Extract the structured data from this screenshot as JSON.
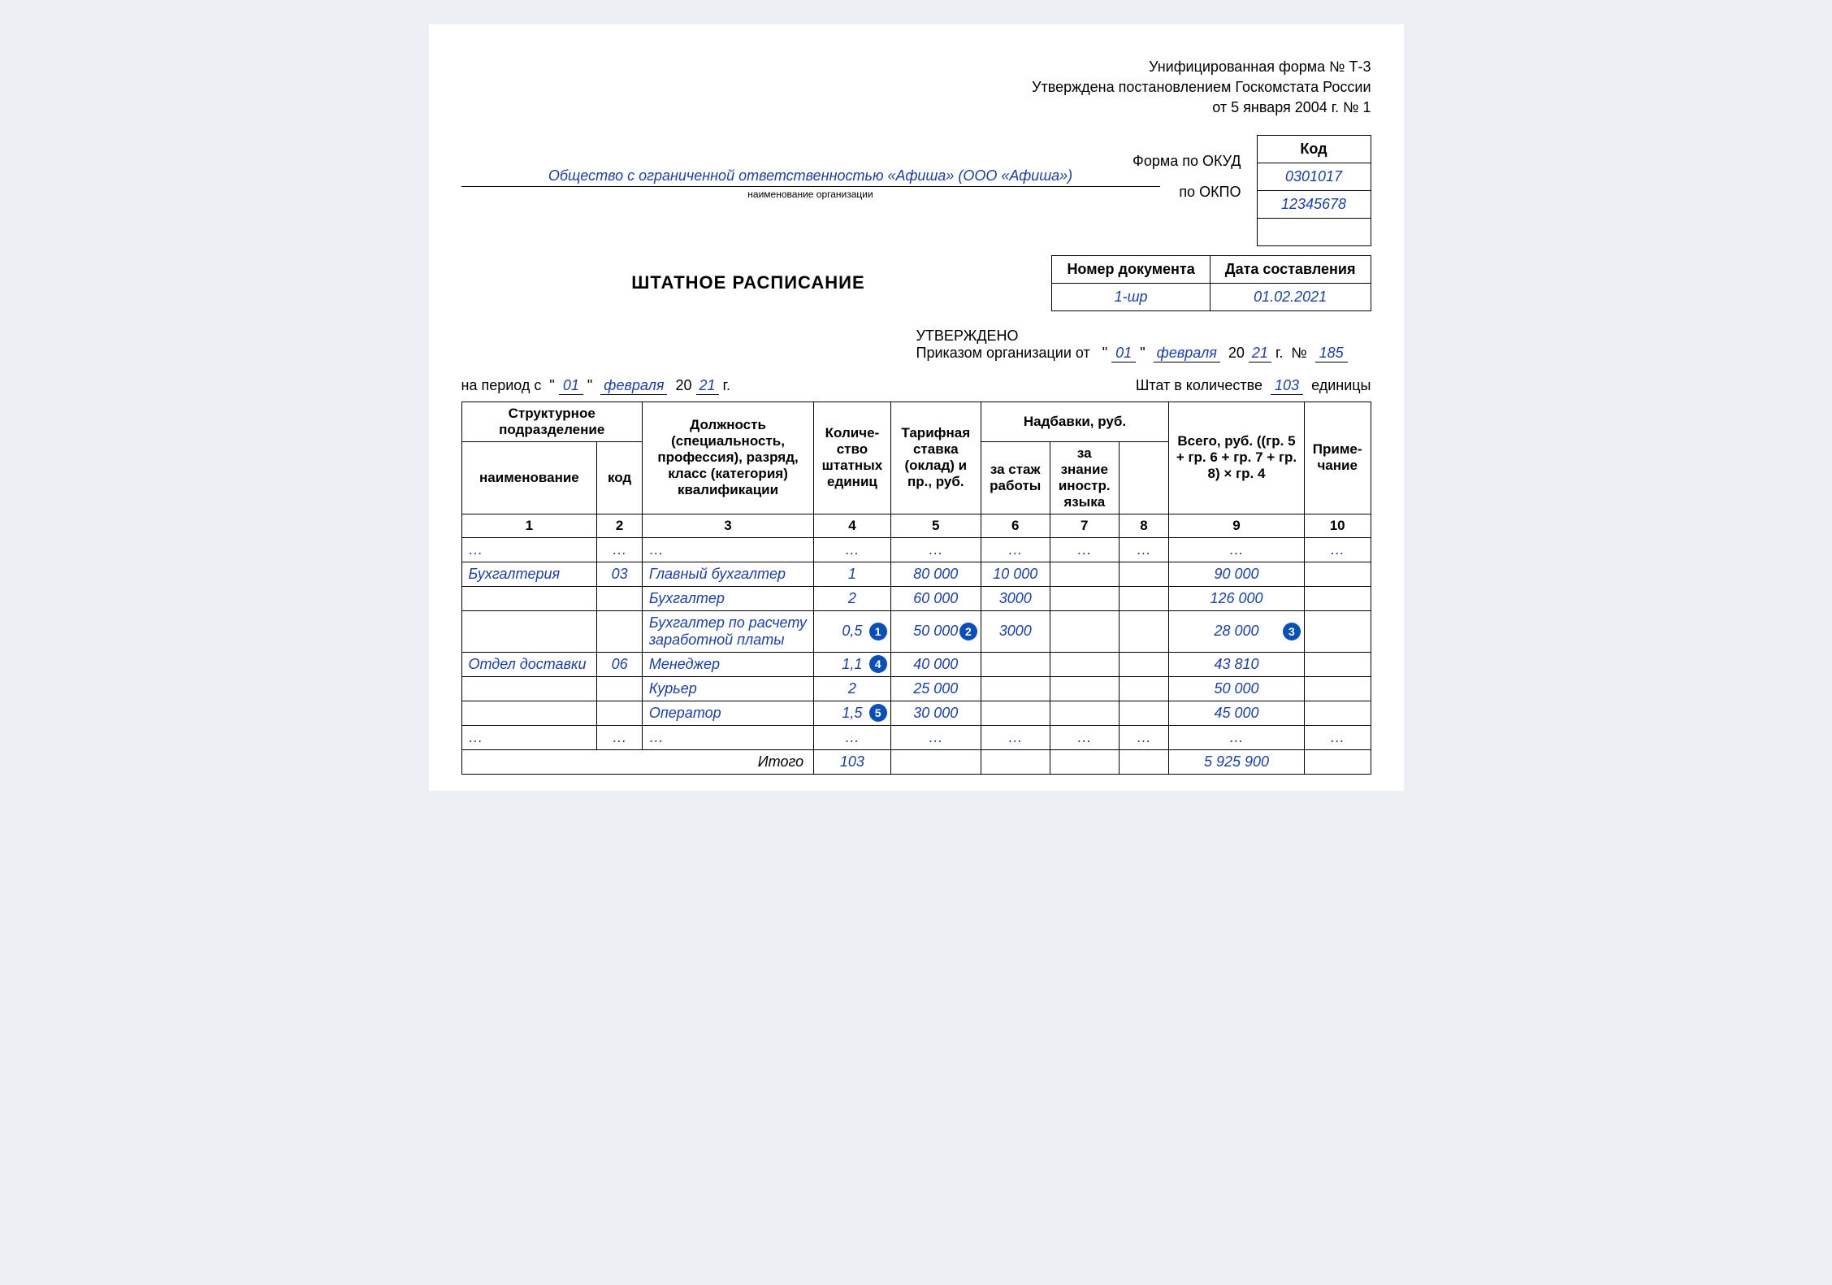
{
  "header": {
    "line1": "Унифицированная форма № Т-3",
    "line2": "Утверждена постановлением Госкомстата России",
    "line3": "от 5 января 2004 г. № 1"
  },
  "codes": {
    "kod_header": "Код",
    "okud_label": "Форма по ОКУД",
    "okud_value": "0301017",
    "okpo_label": "по ОКПО",
    "okpo_value": "12345678"
  },
  "org": {
    "name": "Общество с ограниченной ответственностью «Афиша» (ООО «Афиша»)",
    "caption": "наименование организации"
  },
  "doc": {
    "title": "ШТАТНОЕ РАСПИСАНИЕ",
    "num_header": "Номер документа",
    "date_header": "Дата составления",
    "num_value": "1-шр",
    "date_value": "01.02.2021"
  },
  "approved": {
    "line1": "УТВЕРЖДЕНО",
    "prefix": "Приказом организации от",
    "day": "01",
    "month": "февраля",
    "year_prefix": "20",
    "year": "21",
    "g": "г.",
    "num_sign": "№",
    "num": "185"
  },
  "period": {
    "prefix": "на период  с",
    "day": "01",
    "month": "февраля",
    "year_prefix": "20",
    "year": "21",
    "g": "г."
  },
  "staff": {
    "label": "Штат в количестве",
    "value": "103",
    "unit": "единицы"
  },
  "columns": {
    "struct": "Структурное подразделение",
    "name": "наименование",
    "code": "код",
    "position": "Должность (специальность, профессия), разряд, класс (категория) квалификации",
    "units": "Количе­ство штат­ных единиц",
    "rate": "Тарифная ставка (оклад) и пр., руб.",
    "allowances": "Надбавки, руб.",
    "allow1": "за стаж работы",
    "allow2": "за знание иностр. языка",
    "allow3": "",
    "total": "Всего, руб. ((гр. 5 + гр. 6 + гр. 7 +  гр. 8) × гр. 4",
    "note": "Приме­чание"
  },
  "colnums": [
    "1",
    "2",
    "3",
    "4",
    "5",
    "6",
    "7",
    "8",
    "9",
    "10"
  ],
  "rows": [
    {
      "dept": "…",
      "code": "…",
      "pos": "…",
      "units": "…",
      "rate": "…",
      "a1": "…",
      "a2": "…",
      "a3": "…",
      "total": "…",
      "note": "…"
    },
    {
      "dept": "Бухгалтерия",
      "code": "03",
      "pos": "Главный бухгалтер",
      "units": "1",
      "rate": "80 000",
      "a1": "10 000",
      "a2": "",
      "a3": "",
      "total": "90 000",
      "note": ""
    },
    {
      "dept": "",
      "code": "",
      "pos": "Бухгалтер",
      "units": "2",
      "rate": "60 000",
      "a1": "3000",
      "a2": "",
      "a3": "",
      "total": "126 000",
      "note": ""
    },
    {
      "dept": "",
      "code": "",
      "pos": "Бухгалтер по расчету заработной платы",
      "units": "0,5",
      "rate": "50 000",
      "a1": "3000",
      "a2": "",
      "a3": "",
      "total": "28 000",
      "note": "",
      "badges": {
        "units": "1",
        "rate": "2",
        "total": "3"
      }
    },
    {
      "dept": "Отдел доставки",
      "code": "06",
      "pos": "Менеджер",
      "units": "1,1",
      "rate": "40 000",
      "a1": "",
      "a2": "",
      "a3": "",
      "total": "43 810",
      "note": "",
      "badges": {
        "units": "4"
      }
    },
    {
      "dept": "",
      "code": "",
      "pos": "Курьер",
      "units": "2",
      "rate": "25 000",
      "a1": "",
      "a2": "",
      "a3": "",
      "total": "50 000",
      "note": ""
    },
    {
      "dept": "",
      "code": "",
      "pos": "Оператор",
      "units": "1,5",
      "rate": "30 000",
      "a1": "",
      "a2": "",
      "a3": "",
      "total": "45 000",
      "note": "",
      "badges": {
        "units": "5"
      }
    },
    {
      "dept": "…",
      "code": "…",
      "pos": "…",
      "units": "…",
      "rate": "…",
      "a1": "…",
      "a2": "…",
      "a3": "…",
      "total": "…",
      "note": "…"
    }
  ],
  "totals": {
    "label": "Итого",
    "units": "103",
    "total": "5 925 900"
  },
  "quote": "\""
}
